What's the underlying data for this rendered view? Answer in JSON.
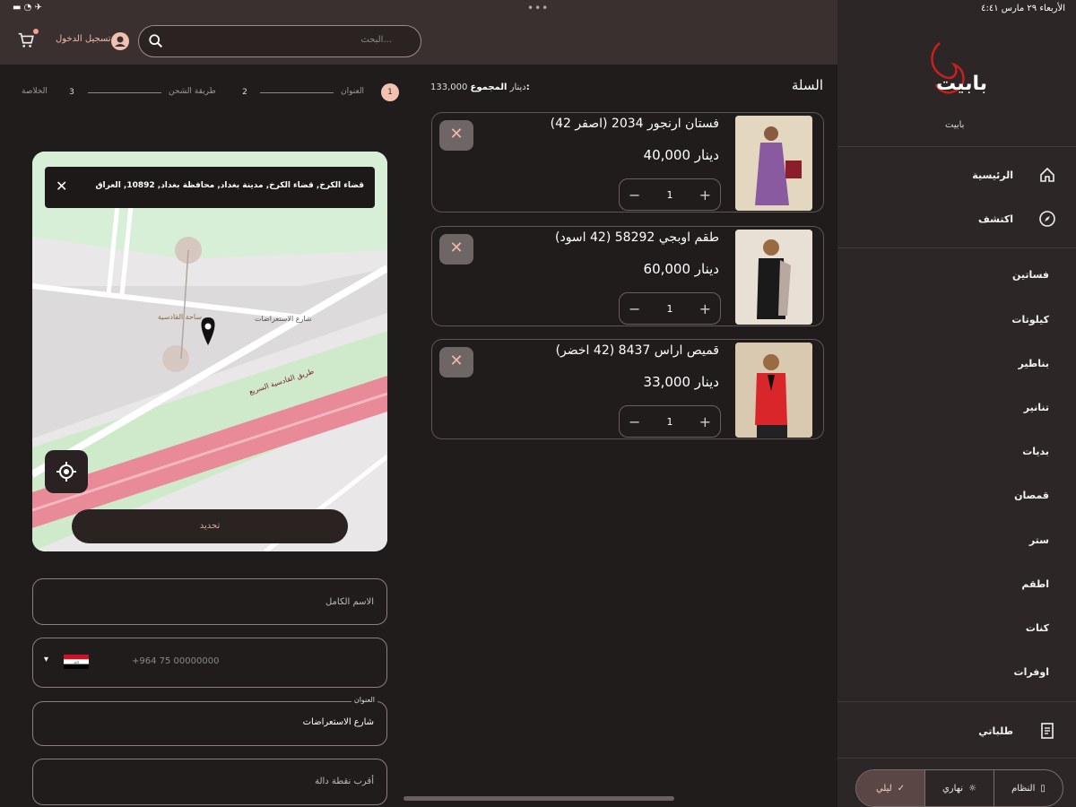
{
  "status_bar": {
    "time": "٤:٤١",
    "date": "الأربعاء ٢٩ مارس",
    "system_icons": "wifi-battery"
  },
  "top_bar": {
    "search_placeholder": "البحث...",
    "login_label": "تسجيل الدخول",
    "icons": [
      "search-icon",
      "avatar-icon",
      "cart-icon"
    ]
  },
  "sidebar": {
    "brand_name": "بابيت",
    "primary": [
      {
        "label": "الرئيسية",
        "icon": "home-icon"
      },
      {
        "label": "اكتشف",
        "icon": "compass-icon"
      }
    ],
    "categories": [
      "فساتين",
      "كيلوتات",
      "بناطير",
      "تنانير",
      "بديات",
      "قمصان",
      "ستر",
      "اطقم",
      "كنات",
      "اوفرات"
    ],
    "orders": {
      "label": "طلباتي",
      "icon": "receipt-icon"
    },
    "theme": {
      "options": [
        {
          "label": "النظام",
          "icon": "phone-icon"
        },
        {
          "label": "نهاري",
          "icon": "sun-icon"
        },
        {
          "label": "ليلي",
          "icon": "check-icon"
        }
      ],
      "selected": "ليلي"
    }
  },
  "cart": {
    "title": "السلة",
    "total_label": "المجموع:",
    "total_value": "133,000 دينار",
    "items": [
      {
        "name": "فستان ارنجور 2034 (اصفر 42)",
        "price": "40,000 دينار",
        "qty": "1",
        "image": "purple-dress"
      },
      {
        "name": "طقم اوبجي 58292 (42 اسود)",
        "price": "60,000 دينار",
        "qty": "1",
        "image": "black-set"
      },
      {
        "name": "قميص اراس 8437 (42 اخضر)",
        "price": "33,000 دينار",
        "qty": "1",
        "image": "red-shirt"
      }
    ]
  },
  "checkout": {
    "steps": [
      {
        "num": "1",
        "label": "العنوان",
        "active": true
      },
      {
        "num": "2",
        "label": "طريقة الشحن",
        "active": false
      },
      {
        "num": "3",
        "label": "الخلاصة",
        "active": false
      }
    ],
    "map": {
      "address_tooltip": "قضاء الكرخ, قضاء الكرخ, مدينة بغداد, محافظة بغداد, 10892, العراق",
      "street_label": "شارع الاستعراضات",
      "highway_label": "طريق القادسية السريع",
      "area_label": "ساحة القادسية",
      "confirm_label": "تحديد"
    },
    "fields": {
      "full_name_placeholder": "الاسم الكامل",
      "phone_placeholder": "+964 75 00000000",
      "address_label": "العنوان",
      "address_value": "شارع الاستعراضات",
      "landmark_placeholder": "أقرب نقطة دالة"
    },
    "country_flag": "iraq-flag"
  },
  "colors": {
    "accent": "#f4c0b0",
    "background": "#201c1c",
    "topbar": "#3a302f",
    "sidebar": "#2d2626"
  }
}
